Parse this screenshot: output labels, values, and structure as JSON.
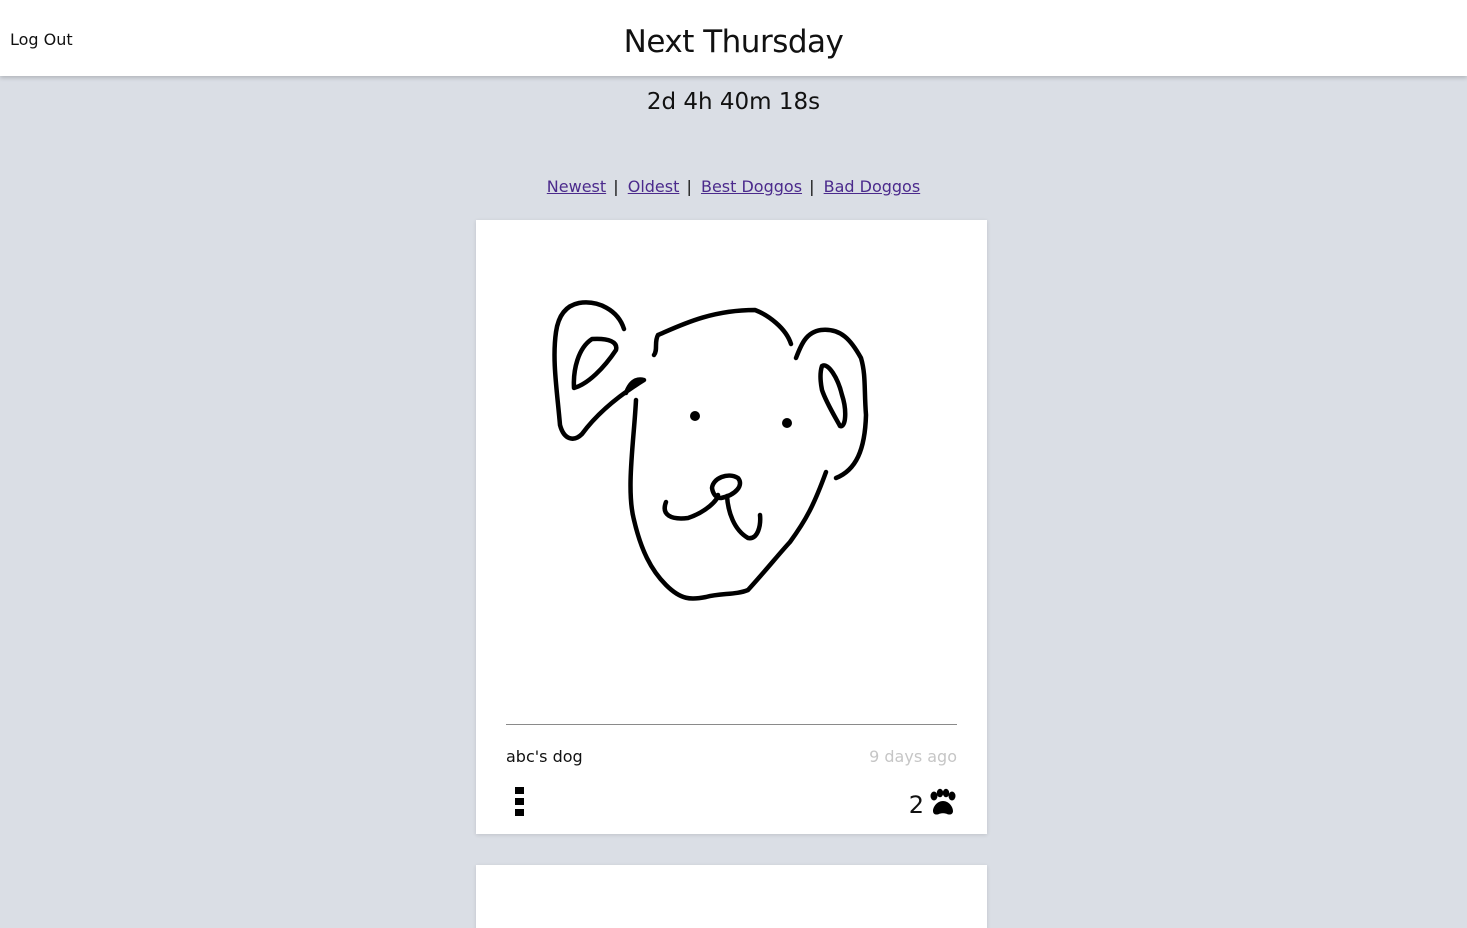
{
  "header": {
    "logout_label": "Log Out",
    "title": "Next Thursday"
  },
  "countdown": "2d 4h 40m 18s",
  "sort": {
    "newest": "Newest",
    "oldest": "Oldest",
    "best": "Best Doggos",
    "bad": "Bad Doggos",
    "separator": "|"
  },
  "posts": [
    {
      "owner": "abc's dog",
      "time_ago": "9 days ago",
      "paw_count": "2",
      "icons": {
        "menu": "vertical-dots-icon",
        "paw": "paw-icon"
      }
    }
  ],
  "colors": {
    "background": "#dadee5",
    "card": "#ffffff",
    "link": "#4b2a8c",
    "muted": "#c6c6c6"
  }
}
